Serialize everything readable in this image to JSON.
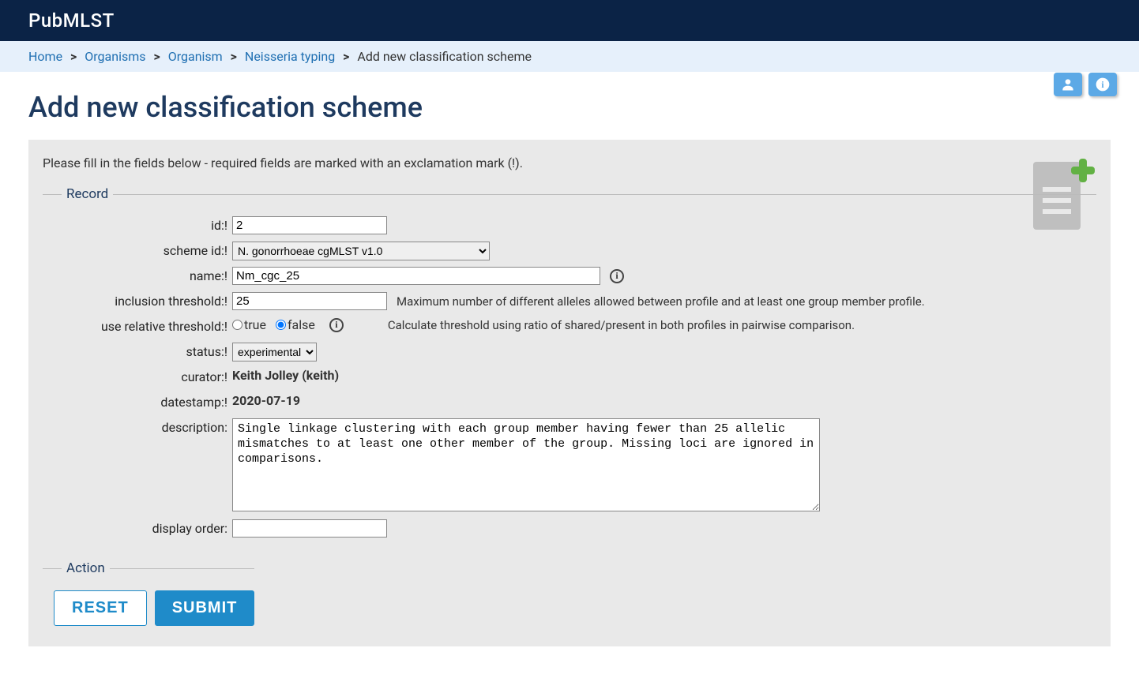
{
  "header": {
    "site_title": "PubMLST"
  },
  "breadcrumb": {
    "items": [
      "Home",
      "Organisms",
      "Organism",
      "Neisseria typing"
    ],
    "current": "Add new classification scheme",
    "sep": ">"
  },
  "page": {
    "title": "Add new classification scheme",
    "intro": "Please fill in the fields below - required fields are marked with an exclamation mark (!)."
  },
  "icons": {
    "user_btn": "user-icon",
    "info_btn": "info-icon",
    "doc_plus": "document-add-icon"
  },
  "form": {
    "record_legend": "Record",
    "action_legend": "Action",
    "labels": {
      "id": "id:!",
      "scheme_id": "scheme id:!",
      "name": "name:!",
      "inclusion_threshold": "inclusion threshold:!",
      "use_relative_threshold": "use relative threshold:!",
      "status": "status:!",
      "curator": "curator:!",
      "datestamp": "datestamp:!",
      "description": "description:",
      "display_order": "display order:"
    },
    "values": {
      "id": "2",
      "scheme_selected": "N. gonorrhoeae cgMLST v1.0",
      "name": "Nm_cgc_25",
      "inclusion_threshold": "25",
      "use_relative_threshold": "false",
      "status_selected": "experimental",
      "curator": "Keith Jolley (keith)",
      "datestamp": "2020-07-19",
      "description_pre": "Single linkage clustering with each group member having fewer than 25 ",
      "description_typo": "allelic",
      "description_post": " mismatches to at least one other member of the group. Missing loci are ignored in comparisons.",
      "description_full": "Single linkage clustering with each group member having fewer than 25 allelic mismatches to at least one other member of the group. Missing loci are ignored in comparisons.",
      "display_order": ""
    },
    "hints": {
      "inclusion_threshold": "Maximum number of different alleles allowed between profile and at least one group member profile.",
      "use_relative_threshold": "Calculate threshold using ratio of shared/present in both profiles in pairwise comparison."
    },
    "radio": {
      "true_label": "true",
      "false_label": "false"
    },
    "buttons": {
      "reset": "RESET",
      "submit": "SUBMIT"
    }
  }
}
